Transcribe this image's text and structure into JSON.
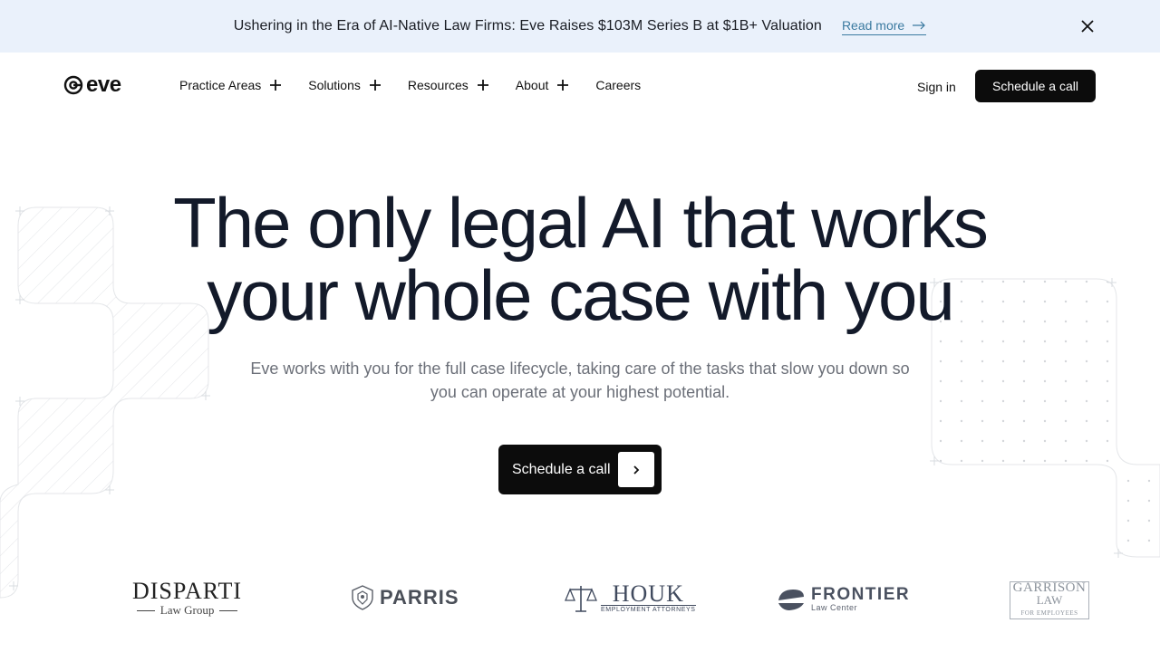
{
  "banner": {
    "text": "Ushering in the Era of AI-Native Law Firms: Eve Raises $103M Series B at $1B+ Valuation",
    "link_label": "Read more",
    "close_icon": "close-icon"
  },
  "header": {
    "logo_text": "eve",
    "nav": [
      {
        "label": "Practice Areas",
        "expandable": true
      },
      {
        "label": "Solutions",
        "expandable": true
      },
      {
        "label": "Resources",
        "expandable": true
      },
      {
        "label": "About",
        "expandable": true
      },
      {
        "label": "Careers",
        "expandable": false
      }
    ],
    "signin_label": "Sign in",
    "cta_label": "Schedule a call"
  },
  "hero": {
    "title_line1": "The only legal AI that works",
    "title_line2": "your whole case with you",
    "subtitle_line1": "Eve works with you for the full case lifecycle, taking care of the tasks that slow you down so",
    "subtitle_line2": "you can operate at your highest potential.",
    "cta_label": "Schedule a call"
  },
  "clients": {
    "disparti": {
      "name": "DISPARTI",
      "sub": "Law Group"
    },
    "parris": {
      "name": "PARRIS"
    },
    "houk": {
      "name": "HOUK",
      "sub": "EMPLOYMENT ATTORNEYS"
    },
    "frontier": {
      "name": "FRONTIER",
      "sub": "Law Center"
    },
    "garrison": {
      "name": "GARRISON",
      "sub2": "LAW",
      "sub": "FOR EMPLOYEES"
    }
  },
  "colors": {
    "banner_bg": "#eaf1fb",
    "link": "#3b7aa0",
    "title": "#131a2a",
    "button_bg": "#0c0c0c"
  }
}
